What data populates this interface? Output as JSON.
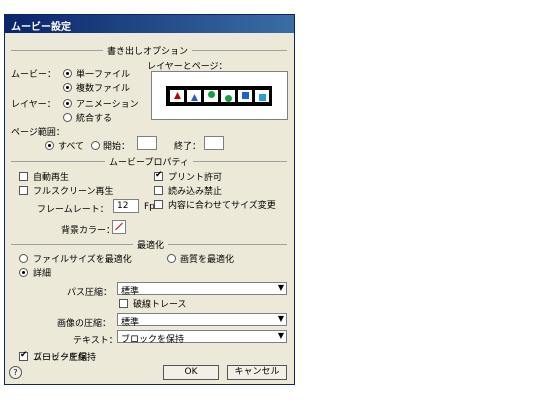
{
  "window": {
    "title": "ムービー設定"
  },
  "export_options": {
    "section": "書き出しオプション",
    "movie_label": "ムービー：",
    "single_file": "単一ファイル",
    "multi_file": "複数ファイル",
    "layers_pages_label": "レイヤーとページ：",
    "layer_label": "レイヤー：",
    "animation": "アニメーション",
    "combine": "統合する",
    "page_range_label": "ページ範囲：",
    "all": "すべて",
    "start": "開始：",
    "end": "終了："
  },
  "movie_properties": {
    "section": "ムービープロパティ",
    "autoplay": "自動再生",
    "fullscreen": "フルスクリーン再生",
    "frame_rate_label": "フレームレート：",
    "frame_rate_value": "12",
    "fps": "Fps",
    "print_allowed": "プリント許可",
    "read_only": "読み込み禁止",
    "fit_size": "内容に合わせてサイズ変更",
    "bg_color_label": "背景カラー："
  },
  "optimization": {
    "section": "最適化",
    "optimize_size": "ファイルサイズを最適化",
    "optimize_quality": "画質を最適化",
    "detail": "詳細",
    "path_compress_label": "パス圧縮：",
    "path_compress_value": "標準",
    "trace_broken": "破線トレース",
    "image_compress_label": "画像の圧縮：",
    "image_compress_value": "標準",
    "text_label": "テキスト：",
    "text_value": "ブロックを保持"
  },
  "footer": {
    "movie_compress": "ムービー圧縮",
    "help": "?",
    "ok": "OK",
    "cancel": "キャンセル"
  },
  "colors": {
    "title_start": "#0a246a",
    "title_end": "#3a6ea5",
    "dialog_bg": "#ece9d8"
  }
}
